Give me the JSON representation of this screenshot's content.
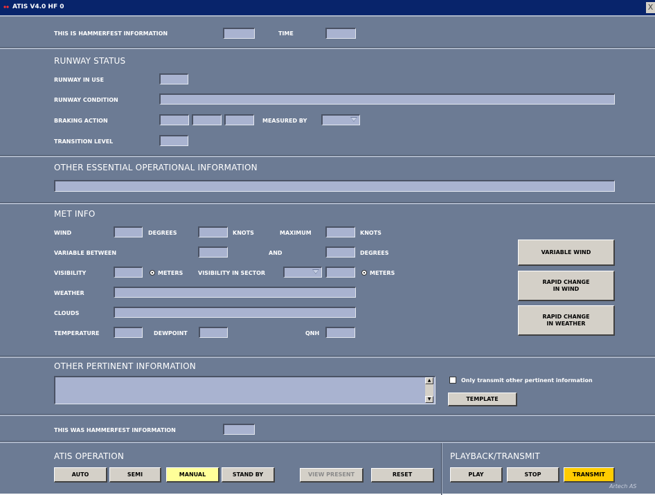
{
  "window": {
    "title": "ATIS V4.0 HF 0",
    "close_label": "X",
    "app_icon": "red-dots-icon"
  },
  "top": {
    "this_is": "THIS IS HAMMERFEST INFORMATION",
    "time": "TIME"
  },
  "runway": {
    "header": "RUNWAY STATUS",
    "in_use": "RUNWAY IN USE",
    "condition": "RUNWAY CONDITION",
    "braking": "BRAKING ACTION",
    "measured_by": "MEASURED BY",
    "transition": "TRANSITION LEVEL"
  },
  "oeoi": {
    "header": "OTHER ESSENTIAL OPERATIONAL INFORMATION"
  },
  "met": {
    "header": "MET INFO",
    "wind": "WIND",
    "degrees": "DEGREES",
    "knots": "KNOTS",
    "maximum": "MAXIMUM",
    "knots2": "KNOTS",
    "variable_between": "VARIABLE BETWEEN",
    "and": "AND",
    "degrees2": "DEGREES",
    "visibility": "VISIBILITY",
    "meters": "METERS",
    "visibility_in_sector": "VISIBILITY IN SECTOR",
    "meters2": "METERS",
    "weather": "WEATHER",
    "clouds": "CLOUDS",
    "temperature": "TEMPERATURE",
    "dewpoint": "DEWPOINT",
    "qnh": "QNH",
    "btn_variable_wind": "VARIABLE WIND",
    "btn_rapid_wind": "RAPID CHANGE\nIN WIND",
    "btn_rapid_weather": "RAPID CHANGE\nIN WEATHER"
  },
  "opi": {
    "header": "OTHER PERTINENT INFORMATION",
    "only_transmit": "Only transmit other pertinent information",
    "template": "TEMPLATE"
  },
  "this_was": {
    "label": "THIS WAS HAMMERFEST INFORMATION"
  },
  "atis_op": {
    "header": "ATIS OPERATION",
    "auto": "AUTO",
    "semi": "SEMI",
    "manual": "MANUAL",
    "standby": "STAND BY",
    "view_present": "VIEW PRESENT",
    "reset": "RESET"
  },
  "playback": {
    "header": "PLAYBACK/TRANSMIT",
    "play": "PLAY",
    "stop": "STOP",
    "transmit": "TRANSMIT"
  },
  "footer": {
    "brand": "Artech AS"
  },
  "colors": {
    "panel": "#6c7b94",
    "field": "#a9b3d0",
    "manual_active": "#ffff99",
    "transmit": "#ffcc00",
    "titlebar": "#08246b"
  }
}
